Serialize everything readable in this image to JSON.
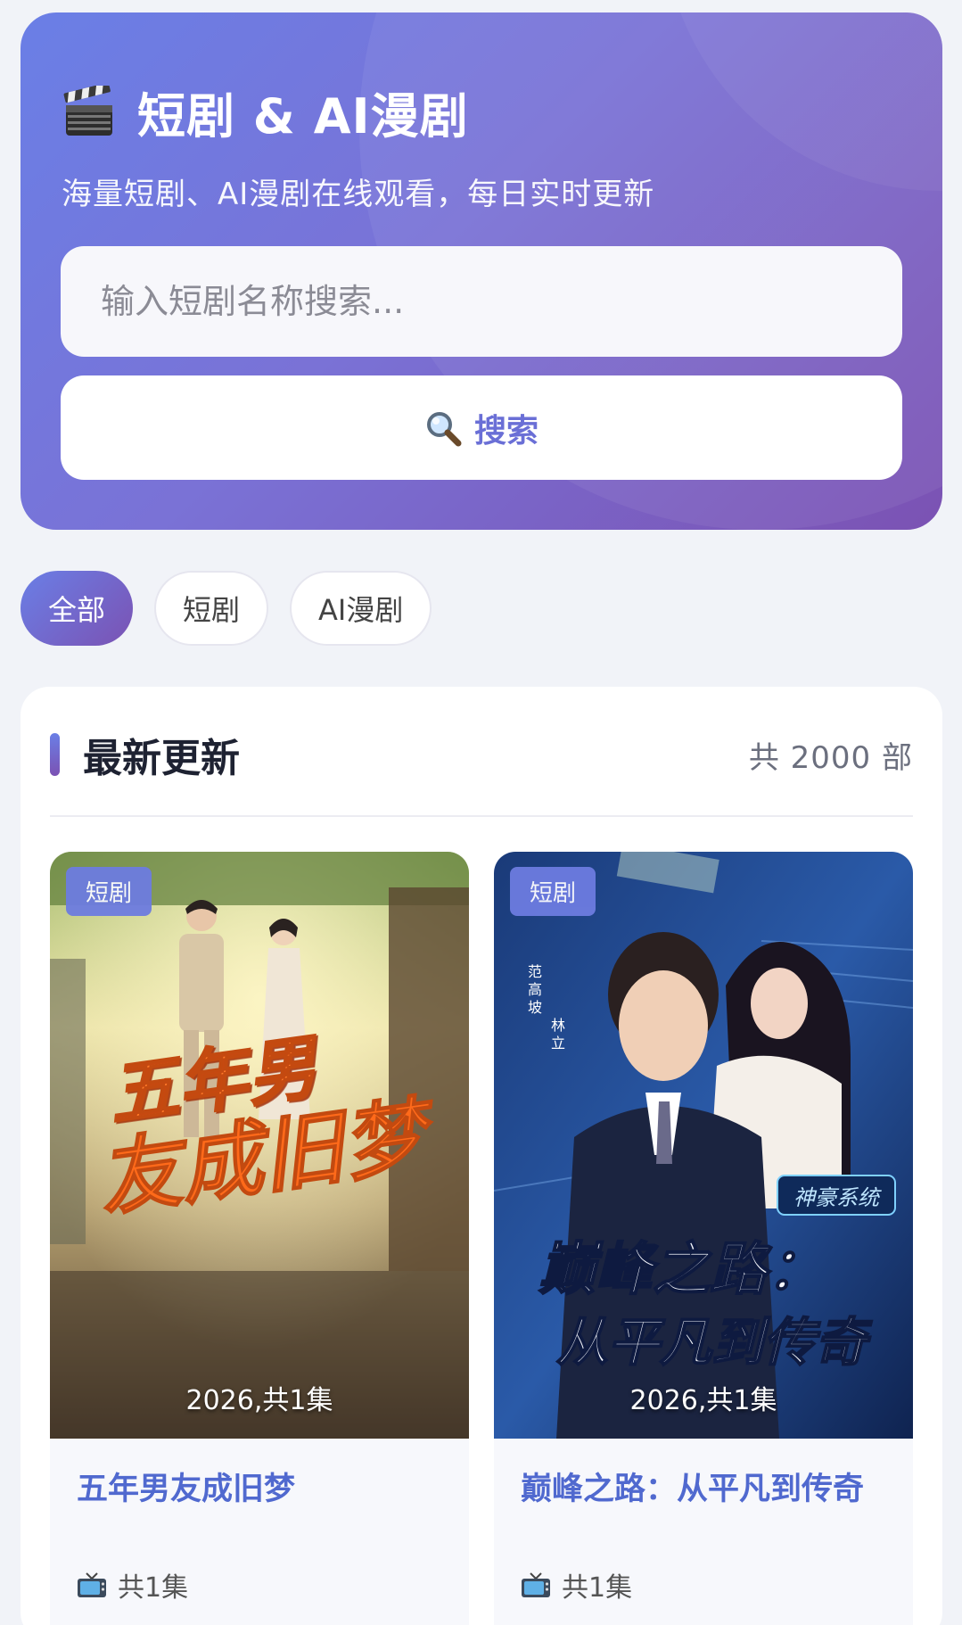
{
  "hero": {
    "title": "短剧 & AI漫剧",
    "subtitle": "海量短剧、AI漫剧在线观看，每日实时更新",
    "search_placeholder": "输入短剧名称搜索...",
    "search_button": "搜索",
    "title_icon": "clapperboard-icon",
    "search_icon": "magnifier-icon"
  },
  "filters": [
    {
      "label": "全部",
      "active": true
    },
    {
      "label": "短剧",
      "active": false
    },
    {
      "label": "AI漫剧",
      "active": false
    }
  ],
  "section": {
    "title": "最新更新",
    "count": "共 2000 部"
  },
  "cards": [
    {
      "tag": "短剧",
      "poster_title": "五年男友成旧梦",
      "poster_year": "2026,共1集",
      "title": "五年男友成旧梦",
      "episodes": "共1集",
      "episodes_icon": "tv-icon"
    },
    {
      "tag": "短剧",
      "poster_title_line1": "巅峰之路：",
      "poster_title_line2": "从平凡到传奇",
      "poster_badge": "神豪系统",
      "poster_year": "2026,共1集",
      "title": "巅峰之路：从平凡到传奇",
      "episodes": "共1集",
      "episodes_icon": "tv-icon"
    }
  ],
  "colors": {
    "accent_start": "#6a7fe6",
    "accent_end": "#7b52b3",
    "card_title": "#5069cf",
    "tag_bg": "#6d7ce0"
  }
}
